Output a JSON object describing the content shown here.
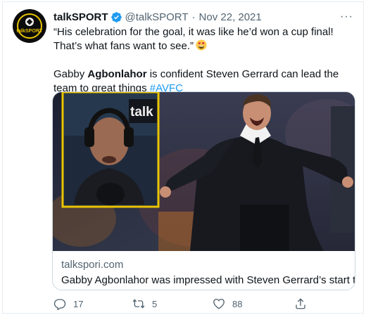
{
  "tweet": {
    "author_name": "talkSPORT",
    "handle": "@talkSPORT",
    "separator": "·",
    "date": "Nov 22, 2021",
    "avatar_text": "talkSPORT",
    "more_label": "···",
    "quote_line": "“His celebration for the goal, it was like he’d won a cup final! That’s what fans want to see.”",
    "body_before": "Gabby ",
    "body_bold": "Agbonlahor",
    "body_after": " is confident Steven Gerrard can lead the team to great things ",
    "hashtag": "#AVFC",
    "emoji": "heart-eyes-emoji"
  },
  "card": {
    "domain": "talkspori.com",
    "title": "Gabby Agbonlahor was impressed with Steven Gerrard’s start to life",
    "inset_sign_text": "talk"
  },
  "actions": {
    "reply_count": "17",
    "retweet_count": "5",
    "like_count": "88"
  },
  "icons": [
    "verified-badge-icon",
    "more-icon",
    "reply-icon",
    "retweet-icon",
    "like-icon",
    "share-icon"
  ],
  "colors": {
    "accent": "#1d9bf0",
    "text": "#0f1419",
    "secondary": "#536471",
    "brand_yellow": "#e9c400"
  }
}
